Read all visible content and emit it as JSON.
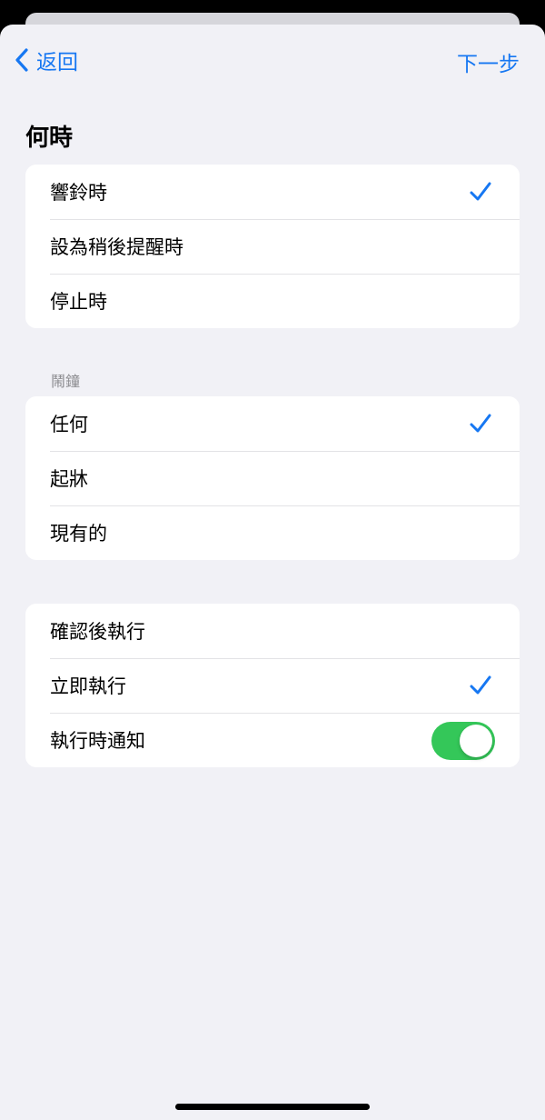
{
  "nav": {
    "back_label": "返回",
    "next_label": "下一步"
  },
  "when": {
    "title": "何時",
    "options": [
      {
        "label": "響鈴時",
        "checked": true
      },
      {
        "label": "設為稍後提醒時",
        "checked": false
      },
      {
        "label": "停止時",
        "checked": false
      }
    ]
  },
  "alarm": {
    "label": "鬧鐘",
    "options": [
      {
        "label": "任何",
        "checked": true
      },
      {
        "label": "起牀",
        "checked": false
      },
      {
        "label": "現有的",
        "checked": false
      }
    ]
  },
  "run": {
    "options": [
      {
        "label": "確認後執行",
        "checked": false
      },
      {
        "label": "立即執行",
        "checked": true
      }
    ],
    "notify_label": "執行時通知",
    "notify_on": true
  },
  "colors": {
    "accent": "#1677f2",
    "toggle_on": "#34c759",
    "background": "#f1f1f6"
  }
}
